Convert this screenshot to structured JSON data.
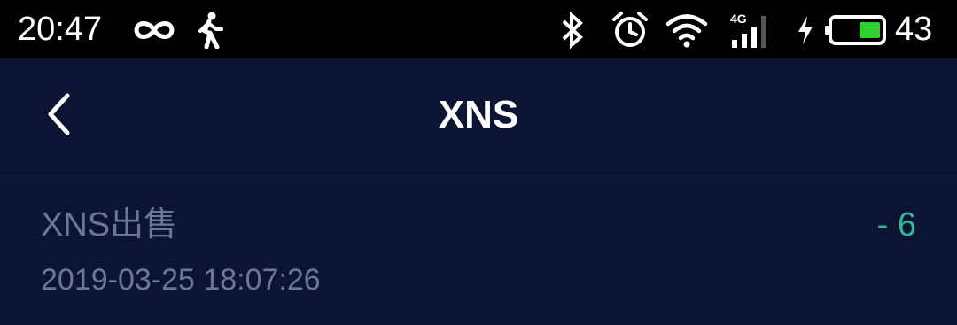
{
  "status_bar": {
    "time": "20:47",
    "battery_level": "43",
    "network": "4G",
    "icons": [
      "infinity-icon",
      "walking-icon",
      "bluetooth-icon",
      "alarm-icon",
      "wifi-icon",
      "signal-icon",
      "charging-icon",
      "battery-icon"
    ]
  },
  "header": {
    "title": "XNS",
    "back_icon": "chevron-left-icon"
  },
  "records": [
    {
      "title": "XNS出售",
      "time": "2019-03-25 18:07:26",
      "amount": "- 6"
    }
  ],
  "colors": {
    "background": "#0b1533",
    "status_bar": "#000000",
    "muted_text": "#6a7798",
    "amount_green": "#33b596",
    "battery_green": "#2fd12f"
  }
}
